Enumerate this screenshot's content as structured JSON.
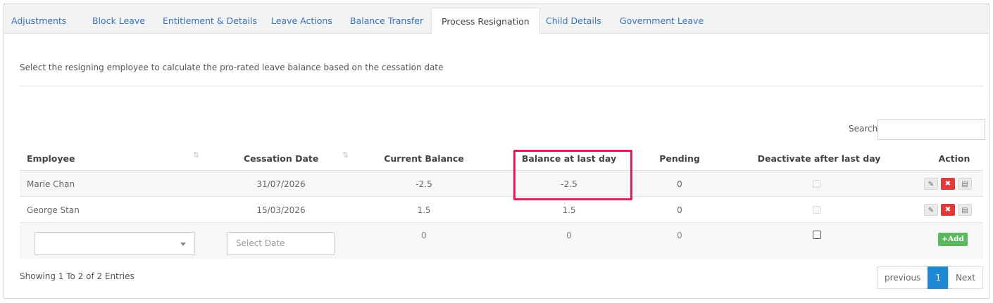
{
  "tabs": [
    {
      "label": "Adjustments"
    },
    {
      "label": "Block Leave"
    },
    {
      "label": "Entitlement & Details"
    },
    {
      "label": "Leave Actions"
    },
    {
      "label": "Balance Transfer"
    },
    {
      "label": "Process Resignation",
      "active": true
    },
    {
      "label": "Child Details"
    },
    {
      "label": "Government Leave"
    }
  ],
  "intro_text": "Select the resigning employee to calculate the pro-rated leave balance based on the cessation date",
  "search": {
    "label": "Search",
    "value": ""
  },
  "table": {
    "headers": {
      "employee": "Employee",
      "cessation_date": "Cessation Date",
      "current_balance": "Current Balance",
      "balance_last_day": "Balance at last day",
      "pending": "Pending",
      "deactivate": "Deactivate after last day",
      "action": "Action"
    },
    "rows": [
      {
        "employee": "Marie Chan",
        "cessation_date": "31/07/2026",
        "current_balance": "-2.5",
        "balance_last_day": "-2.5",
        "pending": "0",
        "deactivate": false
      },
      {
        "employee": "George Stan",
        "cessation_date": "15/03/2026",
        "current_balance": "1.5",
        "balance_last_day": "1.5",
        "pending": "0",
        "deactivate": false
      }
    ],
    "new_row": {
      "employee_value": "",
      "date_placeholder": "Select Date",
      "current_balance": "0",
      "balance_last_day": "0",
      "pending": "0",
      "deactivate": false,
      "add_label": "+Add"
    }
  },
  "footer": {
    "info": "Showing 1 To 2 of 2 Entries",
    "previous": "previous",
    "current_page": "1",
    "next": "Next"
  },
  "colors": {
    "link": "#3b73b9",
    "delete": "#e03a3a",
    "add": "#5cb85c",
    "pager_active": "#1e88d4",
    "highlight": "#e31b5c"
  },
  "icons": {
    "edit": "pencil-icon",
    "delete": "close-icon",
    "view": "document-icon",
    "sort": "sort-icon",
    "dropdown": "caret-down-icon"
  }
}
